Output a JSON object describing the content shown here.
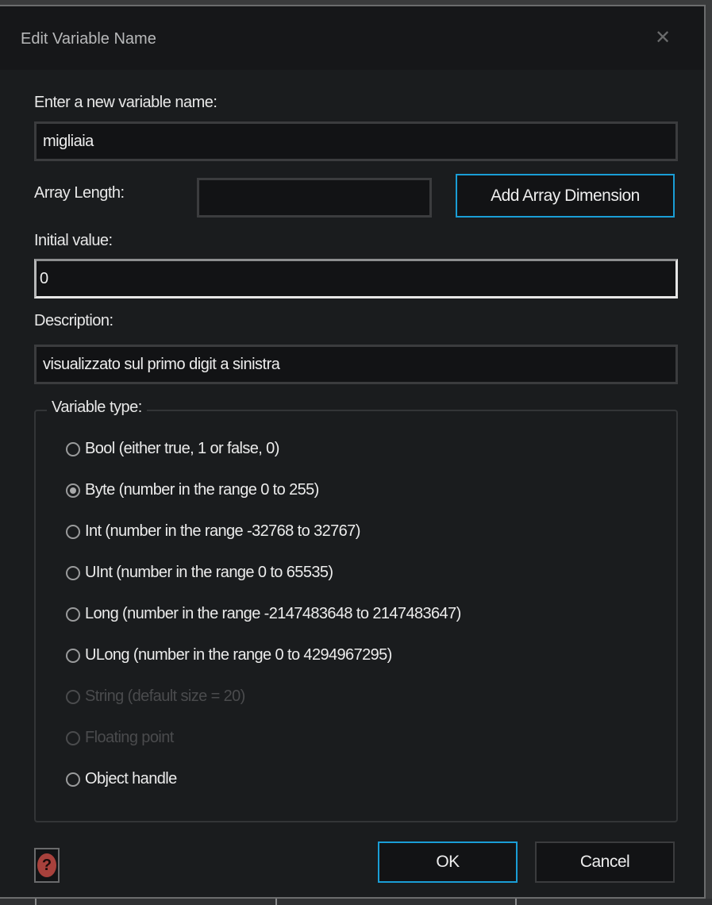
{
  "dialog": {
    "title": "Edit Variable Name",
    "close_icon": "close-icon"
  },
  "form": {
    "name_label": "Enter a new variable name:",
    "name_value": "migliaia",
    "array_length_label": "Array Length:",
    "array_length_value": "",
    "add_array_dimension_label": "Add Array Dimension",
    "initial_value_label": "Initial value:",
    "initial_value": "0",
    "description_label": "Description:",
    "description_value": "visualizzato sul primo digit a sinistra"
  },
  "variable_type": {
    "legend": "Variable type:",
    "options": [
      {
        "label": "Bool (either true, 1 or false, 0)",
        "checked": false,
        "enabled": true
      },
      {
        "label": "Byte (number in the range 0 to 255)",
        "checked": true,
        "enabled": true
      },
      {
        "label": "Int (number in the range -32768 to 32767)",
        "checked": false,
        "enabled": true
      },
      {
        "label": "UInt (number in the range 0 to 65535)",
        "checked": false,
        "enabled": true
      },
      {
        "label": "Long (number in the range -2147483648 to 2147483647)",
        "checked": false,
        "enabled": true
      },
      {
        "label": "ULong (number in the range 0 to 4294967295)",
        "checked": false,
        "enabled": true
      },
      {
        "label": "String (default size = 20)",
        "checked": false,
        "enabled": false
      },
      {
        "label": "Floating point",
        "checked": false,
        "enabled": false
      },
      {
        "label": "Object handle",
        "checked": false,
        "enabled": true
      }
    ]
  },
  "footer": {
    "help_icon": "help-icon",
    "help_glyph": "?",
    "ok_label": "OK",
    "cancel_label": "Cancel"
  },
  "colors": {
    "accent": "#1a9ed6",
    "background": "#1a1c1e",
    "help_icon": "#a8413c"
  }
}
